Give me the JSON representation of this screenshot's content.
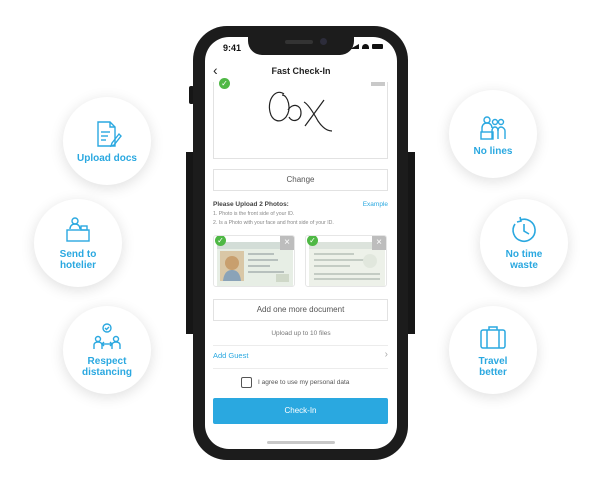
{
  "features_left": [
    {
      "label_lines": [
        "Upload docs"
      ],
      "icon": "upload-docs-icon"
    },
    {
      "label_lines": [
        "Send to",
        "hotelier"
      ],
      "icon": "hotel-reception-icon"
    },
    {
      "label_lines": [
        "Respect",
        "distancing"
      ],
      "icon": "distancing-icon"
    }
  ],
  "features_right": [
    {
      "label_lines": [
        "No lines"
      ],
      "icon": "group-queue-icon"
    },
    {
      "label_lines": [
        "No time",
        "waste"
      ],
      "icon": "timer-icon"
    },
    {
      "label_lines": [
        "Travel",
        "better"
      ],
      "icon": "suitcase-icon"
    }
  ],
  "status_bar": {
    "time": "9:41"
  },
  "app": {
    "title": "Fast Check-In",
    "change_label": "Change",
    "upload_heading": "Please Upload 2 Photos:",
    "example_label": "Example",
    "hint1": "1. Photo is the front side of your ID.",
    "hint2": "2. Is a Photo with your face and front side of your ID.",
    "add_doc_label": "Add one more document",
    "upload_limit": "Upload up to 10 files",
    "add_guest_label": "Add Guest",
    "agree_label": "I agree to use my personal data",
    "checkin_label": "Check-In"
  },
  "colors": {
    "accent": "#2aa8e0",
    "check_green": "#4fb845"
  }
}
